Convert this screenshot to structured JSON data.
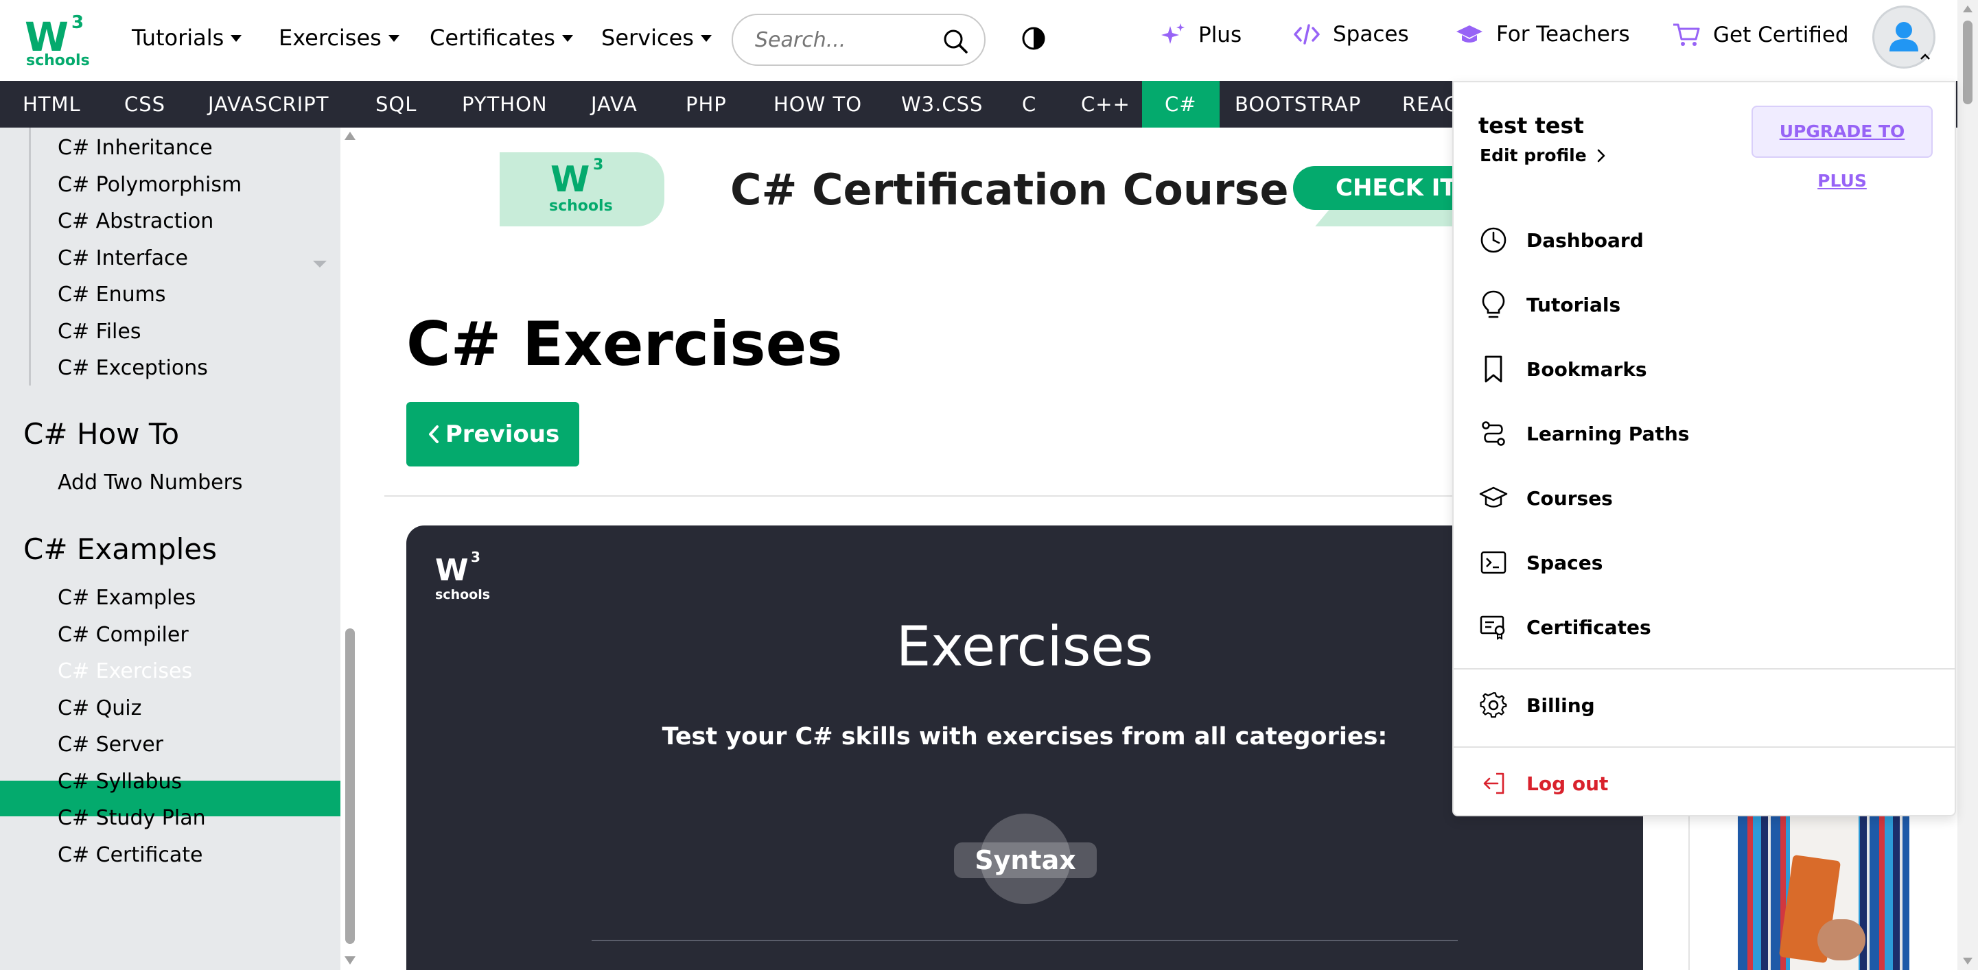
{
  "header": {
    "logo": {
      "w": "W",
      "sup": "3",
      "word": "schools"
    },
    "nav": [
      {
        "label": "Tutorials"
      },
      {
        "label": "Exercises"
      },
      {
        "label": "Certificates"
      },
      {
        "label": "Services"
      }
    ],
    "search_placeholder": "Search...",
    "right": {
      "plus": "Plus",
      "spaces": "Spaces",
      "teachers": "For Teachers",
      "certified": "Get Certified"
    },
    "accent_color": "#04AA6D",
    "plus_color": "#9763F6"
  },
  "subjects": [
    "HTML",
    "CSS",
    "JAVASCRIPT",
    "SQL",
    "PYTHON",
    "JAVA",
    "PHP",
    "HOW TO",
    "W3.CSS",
    "C",
    "C++",
    "C#",
    "BOOTSTRAP",
    "REACT"
  ],
  "active_subject": "C#",
  "sidebar": {
    "top_links": [
      "C# Inheritance",
      "C# Polymorphism",
      "C# Abstraction",
      "C# Interface",
      "C# Enums",
      "C# Files",
      "C# Exceptions"
    ],
    "howto_heading": "C# How To",
    "howto_links": [
      "Add Two Numbers"
    ],
    "examples_heading": "C# Examples",
    "examples_links": [
      "C# Examples",
      "C# Compiler",
      "C# Exercises",
      "C# Quiz",
      "C# Server",
      "C# Syllabus",
      "C# Study Plan",
      "C# Certificate"
    ],
    "active_link": "C# Exercises"
  },
  "main": {
    "banner": {
      "title": "C#  Certification Course",
      "cta": "CHECK IT OUT"
    },
    "page_title": "C# Exercises",
    "prev_label": "Previous",
    "card": {
      "title": "Exercises",
      "subtitle": "Test your C# skills with exercises from all categories:",
      "chip": "Syntax"
    }
  },
  "dropdown": {
    "name": "test test",
    "edit_profile": "Edit profile",
    "upgrade": "UPGRADE TO PLUS",
    "items": [
      {
        "label": "Dashboard",
        "icon": "clock-icon"
      },
      {
        "label": "Tutorials",
        "icon": "lightbulb-icon"
      },
      {
        "label": "Bookmarks",
        "icon": "bookmark-icon"
      },
      {
        "label": "Learning Paths",
        "icon": "route-icon"
      },
      {
        "label": "Courses",
        "icon": "graduation-cap-icon"
      },
      {
        "label": "Spaces",
        "icon": "terminal-icon"
      },
      {
        "label": "Certificates",
        "icon": "certificate-icon"
      }
    ],
    "billing": "Billing",
    "logout": "Log out",
    "logout_color": "#D9212C"
  }
}
